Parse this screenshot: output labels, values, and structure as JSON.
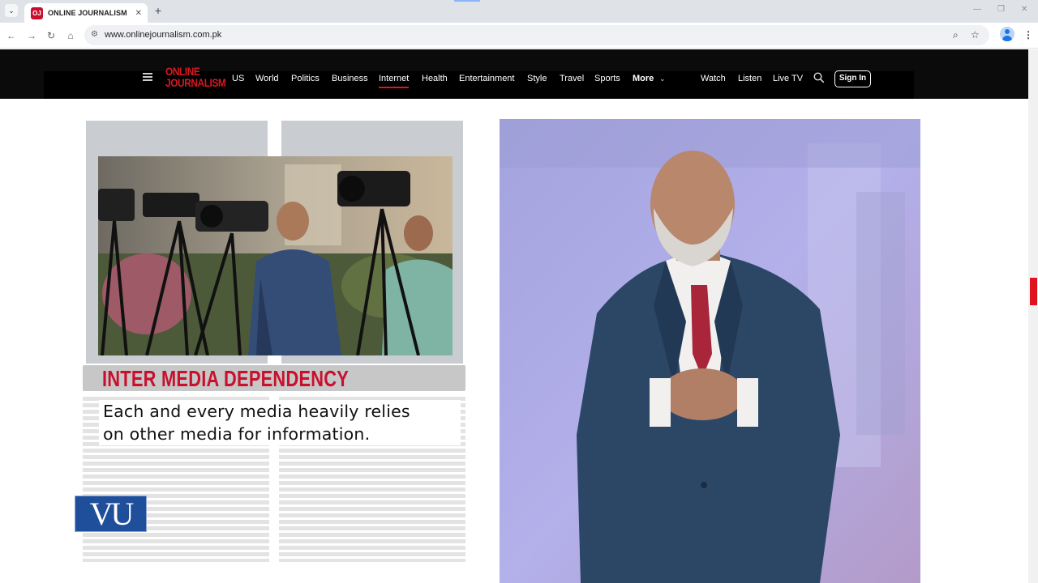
{
  "browser": {
    "tab_title": "ONLINE JOURNALISM",
    "tab_favicon": "OJ",
    "tab_close": "✕",
    "new_tab": "+",
    "url": "www.onlinejournalism.com.pk"
  },
  "site": {
    "logo_line1": "ONLINE",
    "logo_line2": "JOURNALISM",
    "nav_items": [
      "US",
      "World",
      "Politics",
      "Business",
      "Internet",
      "Health",
      "Entertainment",
      "Style",
      "Travel",
      "Sports",
      "More"
    ],
    "active_item": "Internet",
    "right_items": [
      "Watch",
      "Listen",
      "Live TV"
    ],
    "signin_label": "Sign In"
  },
  "slide": {
    "headline": "INTER MEDIA DEPENDENCY",
    "body_line1": "Each and every media heavily relies",
    "body_line2": "on other media for information.",
    "logo_text": "VU"
  },
  "colors": {
    "accent_red": "#c8102e",
    "nav_bg": "#0b0b0b",
    "vu_blue": "#1f4e9a"
  },
  "icons": [
    "menu-icon",
    "back-icon",
    "forward-icon",
    "reload-icon",
    "home-icon",
    "site-info-icon",
    "zoom-icon",
    "bookmark-star-icon",
    "profile-icon",
    "kebab-menu-icon",
    "hamburger-icon",
    "search-icon",
    "chevron-down-icon"
  ]
}
